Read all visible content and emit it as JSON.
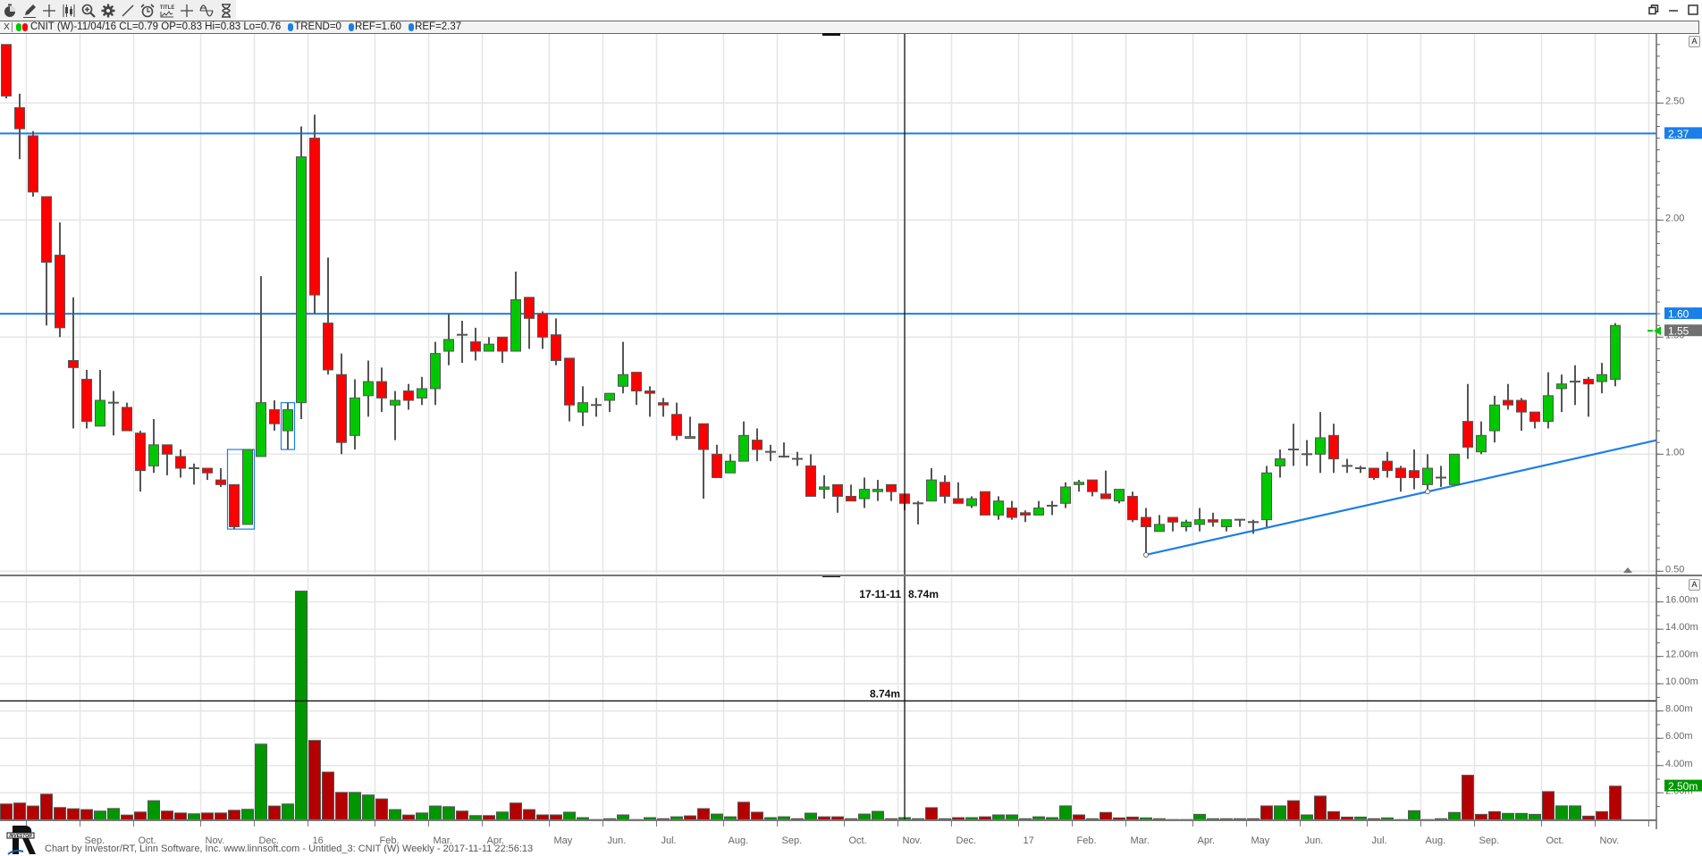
{
  "toolbar": {
    "tools": [
      "timer-icon",
      "pencil-icon",
      "plus-icon",
      "candles-icon",
      "zoom-in-icon",
      "gear-icon",
      "line-icon",
      "alarm-icon",
      "title-icon",
      "crosshair-icon",
      "sine-icon",
      "hourglass-icon"
    ],
    "title_tool_label": "TITLE"
  },
  "legend": {
    "close_label": "X",
    "symbol_text": "CNIT (W)-11/04/16 CL=0.79 OP=0.83 Hi=0.83 Lo=0.76",
    "trend_text": "TREND=0",
    "ref1_text": "REF=1.60",
    "ref2_text": "REF=2.37",
    "colors": {
      "up": "#00c800",
      "down": "#ff0000",
      "ref": "#1a7fe8"
    }
  },
  "panes": {
    "autoscale_label": "A"
  },
  "footer": {
    "text": "Chart by Investor/RT, Linn Software, Inc. www.linnsoft.com - Untitled_3: CNIT (W) Weekly - 2017-11-11 22:56:13",
    "logo_text": "INVESTOR"
  },
  "chart_data": {
    "type": "bar",
    "subtype": "candlestick-with-volume",
    "symbol": "CNIT",
    "period": "Weekly",
    "colors": {
      "up": "#00c800",
      "down": "#ff0000",
      "vol_up": "#009600",
      "vol_down": "#b40000",
      "ref": "#1a7fe8",
      "last": "#707070"
    },
    "x_ticks": [
      {
        "week": 1.5,
        "label": ""
      },
      {
        "week": 5.5,
        "label": "Sep."
      },
      {
        "week": 9.5,
        "label": "Oct."
      },
      {
        "week": 14.5,
        "label": "Nov."
      },
      {
        "week": 18.5,
        "label": "Dec."
      },
      {
        "week": 22.5,
        "label": "16"
      },
      {
        "week": 27.5,
        "label": "Feb."
      },
      {
        "week": 31.5,
        "label": "Mar."
      },
      {
        "week": 35.5,
        "label": "Apr."
      },
      {
        "week": 40.5,
        "label": "May"
      },
      {
        "week": 44.5,
        "label": "Jun."
      },
      {
        "week": 48.5,
        "label": "Jul."
      },
      {
        "week": 53.5,
        "label": "Aug."
      },
      {
        "week": 57.5,
        "label": "Sep."
      },
      {
        "week": 62.5,
        "label": "Oct."
      },
      {
        "week": 66.5,
        "label": "Nov."
      },
      {
        "week": 70.5,
        "label": "Dec."
      },
      {
        "week": 75.5,
        "label": "17"
      },
      {
        "week": 79.5,
        "label": "Feb."
      },
      {
        "week": 83.5,
        "label": "Mar."
      },
      {
        "week": 88.5,
        "label": "Apr."
      },
      {
        "week": 92.5,
        "label": "May"
      },
      {
        "week": 96.5,
        "label": "Jun."
      },
      {
        "week": 101.5,
        "label": "Jul."
      },
      {
        "week": 105.5,
        "label": "Aug."
      },
      {
        "week": 109.5,
        "label": "Sep."
      },
      {
        "week": 114.5,
        "label": "Oct."
      },
      {
        "week": 118.5,
        "label": "Nov."
      },
      {
        "week": 122.5,
        "label": ""
      }
    ],
    "price": {
      "ylim": [
        0.49,
        2.8
      ],
      "y_ticks": [
        {
          "v": 2.5,
          "label": "2.50"
        },
        {
          "v": 2.0,
          "label": "2.00"
        },
        {
          "v": 1.5,
          "label": "1.50"
        },
        {
          "v": 1.0,
          "label": "1.00"
        },
        {
          "v": 0.5,
          "label": "0.50"
        }
      ],
      "ref_lines": [
        {
          "value": 2.37,
          "label": "2.37"
        },
        {
          "value": 1.6,
          "label": "1.60"
        }
      ],
      "last": {
        "value": 1.55,
        "label": "1.55"
      },
      "trend_line": {
        "from": {
          "week": 85,
          "price": 0.57
        },
        "through": {
          "week": 106,
          "price": 0.84
        }
      },
      "highlight_boxes": [
        {
          "weeks": [
            17,
            18
          ],
          "price": [
            0.68,
            1.02
          ]
        },
        {
          "weeks": [
            21,
            21
          ],
          "price": [
            1.02,
            1.22
          ]
        }
      ],
      "ohlc": [
        [
          2.75,
          2.75,
          2.52,
          2.53
        ],
        [
          2.48,
          2.54,
          2.26,
          2.39
        ],
        [
          2.36,
          2.38,
          2.1,
          2.12
        ],
        [
          2.1,
          2.1,
          1.55,
          1.82
        ],
        [
          1.85,
          1.99,
          1.5,
          1.54
        ],
        [
          1.4,
          1.67,
          1.11,
          1.37
        ],
        [
          1.32,
          1.36,
          1.11,
          1.14
        ],
        [
          1.12,
          1.36,
          1.12,
          1.23
        ],
        [
          1.22,
          1.27,
          1.08,
          1.22
        ],
        [
          1.2,
          1.22,
          1.1,
          1.1
        ],
        [
          1.09,
          1.1,
          0.84,
          0.93
        ],
        [
          0.95,
          1.15,
          0.92,
          1.04
        ],
        [
          1.04,
          1.04,
          0.91,
          1.0
        ],
        [
          0.99,
          1.02,
          0.9,
          0.94
        ],
        [
          0.94,
          0.96,
          0.87,
          0.94
        ],
        [
          0.94,
          0.94,
          0.89,
          0.92
        ],
        [
          0.89,
          0.94,
          0.86,
          0.87
        ],
        [
          0.87,
          0.87,
          0.68,
          0.69
        ],
        [
          0.7,
          1.02,
          0.7,
          1.02
        ],
        [
          0.99,
          1.76,
          0.99,
          1.22
        ],
        [
          1.19,
          1.23,
          1.1,
          1.13
        ],
        [
          1.1,
          1.22,
          1.02,
          1.19
        ],
        [
          1.22,
          2.4,
          1.15,
          2.27
        ],
        [
          2.35,
          2.45,
          1.6,
          1.68
        ],
        [
          1.56,
          1.84,
          1.34,
          1.36
        ],
        [
          1.34,
          1.43,
          1.0,
          1.05
        ],
        [
          1.08,
          1.32,
          1.02,
          1.24
        ],
        [
          1.25,
          1.4,
          1.16,
          1.31
        ],
        [
          1.31,
          1.37,
          1.18,
          1.24
        ],
        [
          1.21,
          1.27,
          1.06,
          1.23
        ],
        [
          1.27,
          1.3,
          1.19,
          1.23
        ],
        [
          1.24,
          1.33,
          1.21,
          1.28
        ],
        [
          1.28,
          1.48,
          1.21,
          1.43
        ],
        [
          1.44,
          1.6,
          1.38,
          1.49
        ],
        [
          1.51,
          1.57,
          1.39,
          1.51
        ],
        [
          1.48,
          1.54,
          1.4,
          1.44
        ],
        [
          1.44,
          1.5,
          1.44,
          1.47
        ],
        [
          1.5,
          1.5,
          1.39,
          1.44
        ],
        [
          1.44,
          1.78,
          1.44,
          1.66
        ],
        [
          1.67,
          1.67,
          1.45,
          1.58
        ],
        [
          1.6,
          1.61,
          1.45,
          1.5
        ],
        [
          1.51,
          1.58,
          1.38,
          1.4
        ],
        [
          1.41,
          1.41,
          1.14,
          1.21
        ],
        [
          1.18,
          1.29,
          1.12,
          1.22
        ],
        [
          1.21,
          1.24,
          1.16,
          1.21
        ],
        [
          1.23,
          1.26,
          1.18,
          1.26
        ],
        [
          1.29,
          1.48,
          1.26,
          1.34
        ],
        [
          1.35,
          1.35,
          1.21,
          1.27
        ],
        [
          1.27,
          1.29,
          1.16,
          1.26
        ],
        [
          1.22,
          1.24,
          1.16,
          1.21
        ],
        [
          1.17,
          1.22,
          1.06,
          1.08
        ],
        [
          1.07,
          1.16,
          1.07,
          1.075
        ],
        [
          1.13,
          1.13,
          0.81,
          1.02
        ],
        [
          1.0,
          1.04,
          0.9,
          0.9
        ],
        [
          0.92,
          1.0,
          0.92,
          0.97
        ],
        [
          0.97,
          1.14,
          0.97,
          1.08
        ],
        [
          1.06,
          1.11,
          0.97,
          1.02
        ],
        [
          1.01,
          1.04,
          0.97,
          1.01
        ],
        [
          0.99,
          1.05,
          0.985,
          0.99
        ],
        [
          0.98,
          1.01,
          0.95,
          0.98
        ],
        [
          0.95,
          1.0,
          0.82,
          0.82
        ],
        [
          0.85,
          0.91,
          0.81,
          0.86
        ],
        [
          0.87,
          0.87,
          0.75,
          0.82
        ],
        [
          0.82,
          0.87,
          0.8,
          0.8
        ],
        [
          0.81,
          0.9,
          0.77,
          0.85
        ],
        [
          0.84,
          0.89,
          0.8,
          0.85
        ],
        [
          0.87,
          0.87,
          0.8,
          0.84
        ],
        [
          0.83,
          0.83,
          0.76,
          0.79
        ],
        [
          0.79,
          0.8,
          0.7,
          0.79
        ],
        [
          0.8,
          0.94,
          0.8,
          0.89
        ],
        [
          0.88,
          0.91,
          0.79,
          0.82
        ],
        [
          0.81,
          0.88,
          0.79,
          0.79
        ],
        [
          0.78,
          0.82,
          0.77,
          0.81
        ],
        [
          0.84,
          0.84,
          0.74,
          0.74
        ],
        [
          0.74,
          0.82,
          0.72,
          0.8
        ],
        [
          0.77,
          0.8,
          0.72,
          0.73
        ],
        [
          0.75,
          0.76,
          0.71,
          0.74
        ],
        [
          0.74,
          0.8,
          0.74,
          0.77
        ],
        [
          0.78,
          0.8,
          0.74,
          0.78
        ],
        [
          0.79,
          0.88,
          0.77,
          0.86
        ],
        [
          0.87,
          0.89,
          0.84,
          0.88
        ],
        [
          0.89,
          0.89,
          0.82,
          0.84
        ],
        [
          0.83,
          0.93,
          0.81,
          0.81
        ],
        [
          0.8,
          0.85,
          0.79,
          0.85
        ],
        [
          0.82,
          0.84,
          0.71,
          0.72
        ],
        [
          0.73,
          0.77,
          0.57,
          0.69
        ],
        [
          0.67,
          0.74,
          0.67,
          0.7
        ],
        [
          0.73,
          0.73,
          0.67,
          0.71
        ],
        [
          0.69,
          0.72,
          0.67,
          0.71
        ],
        [
          0.7,
          0.77,
          0.67,
          0.72
        ],
        [
          0.72,
          0.75,
          0.69,
          0.71
        ],
        [
          0.69,
          0.72,
          0.67,
          0.72
        ],
        [
          0.72,
          0.72,
          0.69,
          0.72
        ],
        [
          0.71,
          0.72,
          0.66,
          0.71
        ],
        [
          0.72,
          0.95,
          0.69,
          0.92
        ],
        [
          0.95,
          1.02,
          0.9,
          0.98
        ],
        [
          1.02,
          1.13,
          0.95,
          1.02
        ],
        [
          1.0,
          1.06,
          0.95,
          1.0
        ],
        [
          1.0,
          1.18,
          0.92,
          1.07
        ],
        [
          1.08,
          1.13,
          0.92,
          0.98
        ],
        [
          0.95,
          0.98,
          0.92,
          0.95
        ],
        [
          0.94,
          0.95,
          0.92,
          0.94
        ],
        [
          0.94,
          0.94,
          0.89,
          0.9
        ],
        [
          0.97,
          1.01,
          0.9,
          0.93
        ],
        [
          0.94,
          0.95,
          0.84,
          0.9
        ],
        [
          0.93,
          1.02,
          0.85,
          0.9
        ],
        [
          0.87,
          1.0,
          0.85,
          0.94
        ],
        [
          0.9,
          0.95,
          0.86,
          0.9
        ],
        [
          0.87,
          1.0,
          0.87,
          1.0
        ],
        [
          1.14,
          1.3,
          0.98,
          1.03
        ],
        [
          1.01,
          1.14,
          1.0,
          1.08
        ],
        [
          1.1,
          1.25,
          1.05,
          1.21
        ],
        [
          1.23,
          1.3,
          1.19,
          1.21
        ],
        [
          1.23,
          1.24,
          1.1,
          1.18
        ],
        [
          1.18,
          1.18,
          1.11,
          1.14
        ],
        [
          1.14,
          1.35,
          1.11,
          1.25
        ],
        [
          1.28,
          1.34,
          1.18,
          1.3
        ],
        [
          1.31,
          1.38,
          1.21,
          1.31
        ],
        [
          1.32,
          1.33,
          1.16,
          1.3
        ],
        [
          1.31,
          1.39,
          1.26,
          1.34
        ],
        [
          1.32,
          1.56,
          1.29,
          1.55
        ]
      ]
    },
    "volume": {
      "unit": "m",
      "ylim": [
        0,
        17.9
      ],
      "y_ticks": [
        {
          "v": 16,
          "label": "16.00m"
        },
        {
          "v": 14,
          "label": "14.00m"
        },
        {
          "v": 12,
          "label": "12.00m"
        },
        {
          "v": 10,
          "label": "10.00m"
        },
        {
          "v": 8,
          "label": "8.00m"
        },
        {
          "v": 6,
          "label": "6.00m"
        },
        {
          "v": 4,
          "label": "4.00m"
        },
        {
          "v": 2,
          "label": "2.00m"
        }
      ],
      "last": {
        "value": 2.5,
        "label": "2.50m"
      },
      "values": [
        1.18,
        1.25,
        1.03,
        1.9,
        0.92,
        0.83,
        0.77,
        0.66,
        0.85,
        0.37,
        0.59,
        1.42,
        0.66,
        0.52,
        0.46,
        0.52,
        0.52,
        0.72,
        0.79,
        5.57,
        1.03,
        1.18,
        16.79,
        5.84,
        3.52,
        2.03,
        2.03,
        1.84,
        1.55,
        0.77,
        0.37,
        0.52,
        1.03,
        0.98,
        0.66,
        0.33,
        0.33,
        0.59,
        1.25,
        0.77,
        0.38,
        0.38,
        0.58,
        0.18,
        0.04,
        0.1,
        0.38,
        0.04,
        0.18,
        0.1,
        0.24,
        0.31,
        0.84,
        0.44,
        0.24,
        1.31,
        0.58,
        0.18,
        0.24,
        0.1,
        0.51,
        0.24,
        0.24,
        0.1,
        0.44,
        0.64,
        0.1,
        0.18,
        0.1,
        0.91,
        0.1,
        0.18,
        0.18,
        0.24,
        0.38,
        0.38,
        0.1,
        0.24,
        0.18,
        1.04,
        0.38,
        0.1,
        0.56,
        0.16,
        0.22,
        0.16,
        0.1,
        0.04,
        0.04,
        0.42,
        0.1,
        0.1,
        0.1,
        0.1,
        1.04,
        1.04,
        1.42,
        0.38,
        1.76,
        0.62,
        0.22,
        0.22,
        0.1,
        0.16,
        0.04,
        0.69,
        0.04,
        0.1,
        0.56,
        3.29,
        0.42,
        0.62,
        0.49,
        0.49,
        0.42,
        2.09,
        1.04,
        1.04,
        0.29,
        0.62,
        2.49
      ],
      "direction": "rrrrrrrggrrgrrgrrrggrggrrrggrgrgggrgrgrrrrgggggrgrgrrggrrggrgrrgggrggrgrgrggggggrgrrrggggggggrrgrgrrrgrgggrggrrrgggrgg"
    },
    "crosshair": {
      "week": 67,
      "volume_level": 8.74,
      "readout_date": "17-11-11",
      "readout_value": "8.74m",
      "level_label": "8.74m"
    }
  }
}
